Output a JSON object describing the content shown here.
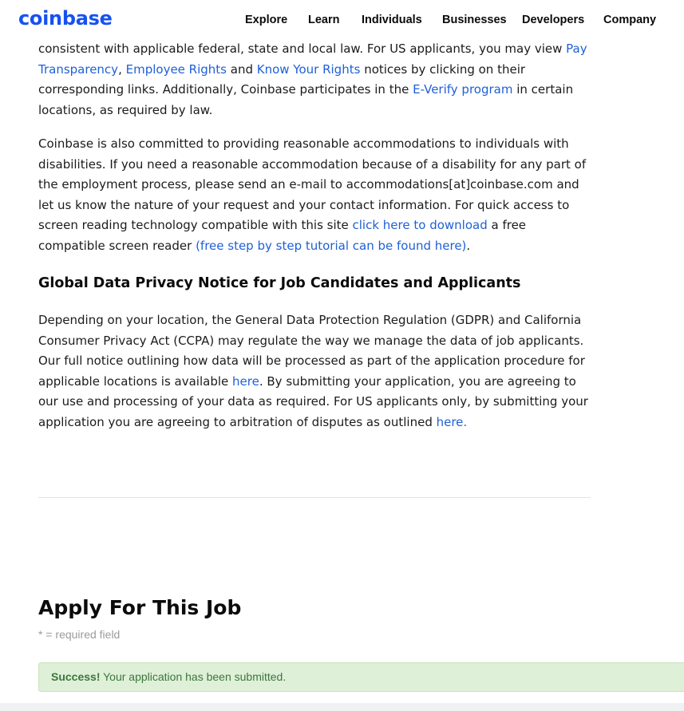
{
  "header": {
    "logo": "coinbase",
    "nav": [
      "Explore",
      "Learn",
      "Individuals",
      "Businesses",
      "Developers",
      "Company"
    ]
  },
  "para1": {
    "t1": "consistent with applicable federal, state and local law.  For US applicants, you may view ",
    "link1": "Pay Transparency",
    "t2": ", ",
    "link2": "Employee Rights",
    "t3": " and ",
    "link3": "Know Your Rights",
    "t4": " notices by clicking on their corresponding links.  Additionally, Coinbase participates in the ",
    "link4": "E-Verify program",
    "t5": " in certain locations, as required by law."
  },
  "para2": {
    "t1": "Coinbase is also committed to providing reasonable accommodations to individuals with disabilities. If you need a reasonable accommodation because of a disability for any part of the employment process, please send an e-mail to accommodations[at]coinbase.com and let us know the nature of your request and your contact information.  For quick access to screen reading technology compatible with this site ",
    "link1": "click here to download",
    "t2": " a free compatible screen reader ",
    "link2": "(free step by step tutorial can be found here)",
    "t3": "."
  },
  "privacy": {
    "title": "Global Data Privacy Notice for Job Candidates and Applicants",
    "t1": "Depending on your location, the General Data Protection Regulation (GDPR) and California Consumer Privacy Act (CCPA) may regulate the way we manage the data of job applicants. Our full notice outlining how data will be processed as part of the application procedure for applicable locations is available ",
    "link1": "here",
    "t2": ". By submitting your application, you are agreeing to our use and processing of your data as required. For US applicants only, by submitting your application you are agreeing to arbitration of disputes as outlined ",
    "link2": "here."
  },
  "apply": {
    "title": "Apply For This Job",
    "required_note": "* = required field",
    "success_label": "Success!",
    "success_message": " Your application has been submitted."
  },
  "colors": {
    "brand": "#1652f0",
    "link": "#1f60d7",
    "success_bg": "#dff0d8",
    "success_text": "#3c763d"
  }
}
